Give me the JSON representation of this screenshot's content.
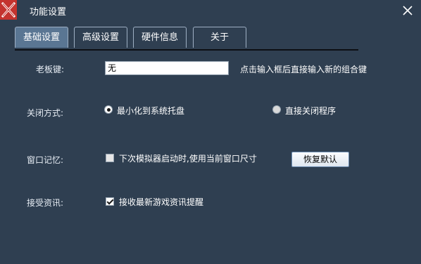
{
  "window": {
    "title": "功能设置",
    "logo_icon": "x-logo-icon",
    "close_icon": "close-icon",
    "logo_color": "#c4332e"
  },
  "tabs": [
    {
      "label": "基础设置",
      "active": true
    },
    {
      "label": "高级设置",
      "active": false
    },
    {
      "label": "硬件信息",
      "active": false
    },
    {
      "label": "关于",
      "active": false
    }
  ],
  "boss_key": {
    "label": "老板键:",
    "value": "无",
    "hint": "点击输入框后直接输入新的组合键"
  },
  "close_mode": {
    "label": "关闭方式:",
    "options": [
      {
        "label": "最小化到系统托盘",
        "checked": true
      },
      {
        "label": "直接关闭程序",
        "checked": false
      }
    ]
  },
  "window_memory": {
    "label": "窗口记忆:",
    "checkbox_label": "下次模拟器启动时,使用当前窗口尺寸",
    "checked": false,
    "restore_button": "恢复默认"
  },
  "news": {
    "label": "接受资讯:",
    "checkbox_label": "接收最新游戏资讯提醒",
    "checked": true
  },
  "colors": {
    "background": "#2f3f51",
    "active_tab": "#5a7693"
  }
}
